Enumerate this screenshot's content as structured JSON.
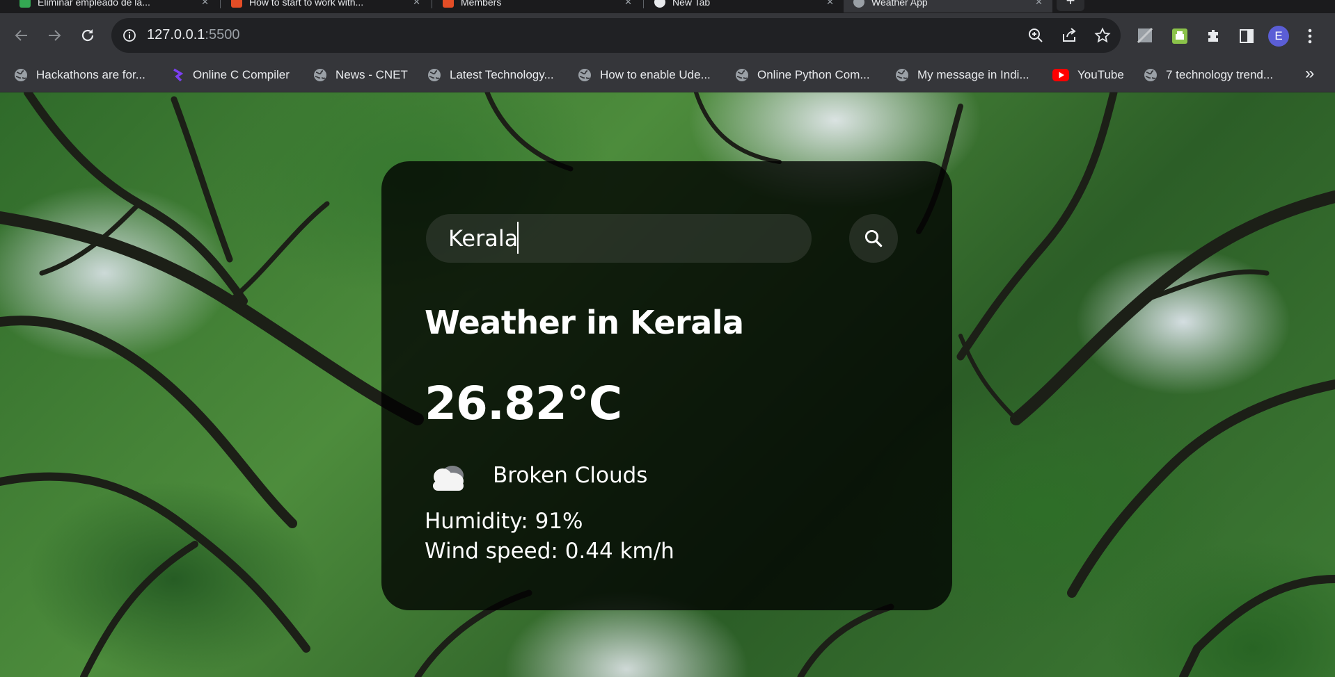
{
  "browser": {
    "tabs": [
      {
        "label": "Eliminar empleado de la..."
      },
      {
        "label": "How to start to work with..."
      },
      {
        "label": "Members"
      },
      {
        "label": "New Tab"
      },
      {
        "label": "Weather App",
        "active": true
      }
    ],
    "new_tab_label": "+",
    "url_host": "127.0.0.1",
    "url_port": ":5500",
    "avatar_initial": "E",
    "bookmarks": [
      {
        "label": "Hackathons are for...",
        "icon": "globe-icon"
      },
      {
        "label": "Online C Compiler",
        "icon": "programiz-icon"
      },
      {
        "label": "News - CNET",
        "icon": "globe-icon"
      },
      {
        "label": "Latest Technology...",
        "icon": "globe-icon"
      },
      {
        "label": "How to enable Ude...",
        "icon": "globe-icon"
      },
      {
        "label": "Online Python Com...",
        "icon": "globe-icon"
      },
      {
        "label": "My message in Indi...",
        "icon": "globe-icon"
      },
      {
        "label": "YouTube",
        "icon": "youtube-icon"
      },
      {
        "label": "7 technology trend...",
        "icon": "globe-icon"
      }
    ],
    "bookmarks_overflow": "»"
  },
  "weather": {
    "search_value": "Kerala",
    "city_heading": "Weather in Kerala",
    "temperature": "26.82°C",
    "condition": "Broken Clouds",
    "condition_icon": "cloud-icon",
    "humidity": "Humidity: 91%",
    "wind": "Wind speed: 0.44 km/h"
  },
  "colors": {
    "chrome": "#35363a",
    "omnibox": "#202124",
    "card_bg": "rgba(0,0,0,0.78)",
    "avatar": "#5b5ed6"
  }
}
